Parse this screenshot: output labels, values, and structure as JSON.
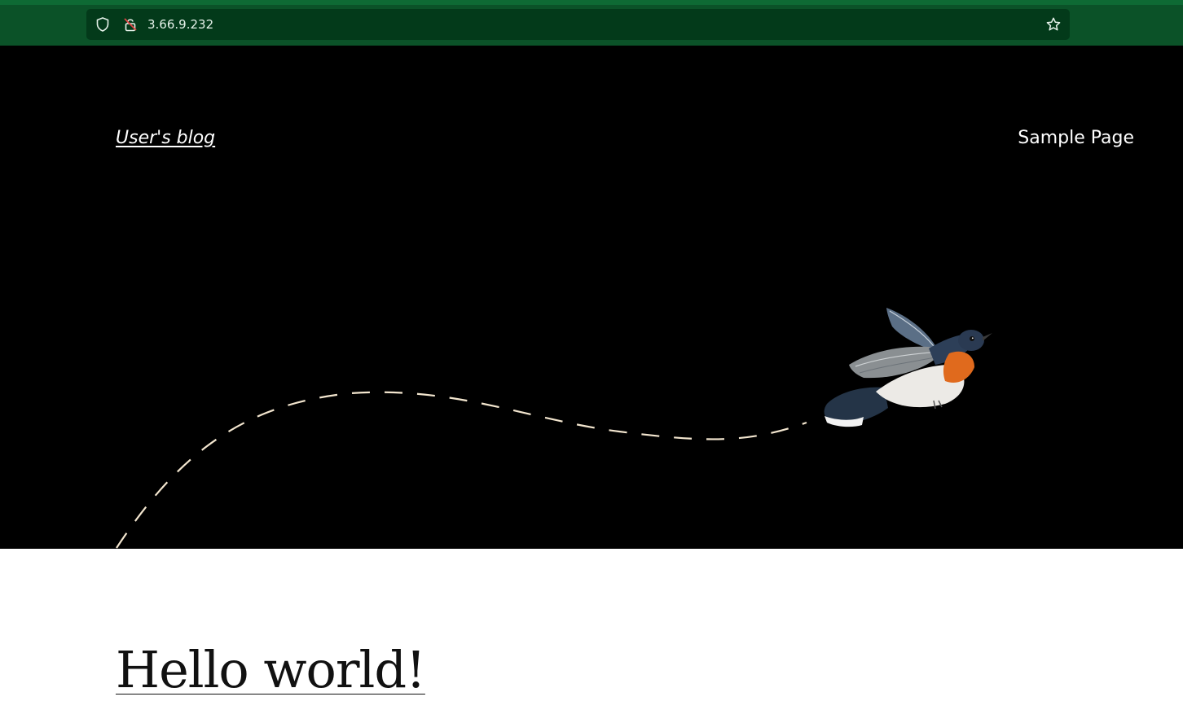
{
  "browser": {
    "url": "3.66.9.232",
    "icons": [
      "shield-icon",
      "insecure-lock-icon",
      "bookmark-star-icon"
    ],
    "colors": {
      "chrome": "#0b5228",
      "urlbar": "#033a1a"
    }
  },
  "header": {
    "site_title": "User's blog",
    "nav": [
      {
        "label": "Sample Page"
      }
    ]
  },
  "hero": {
    "background": "#000000",
    "illustration": "bird-illustration",
    "path_color": "#f3e6cf"
  },
  "post": {
    "title": "Hello world!"
  }
}
